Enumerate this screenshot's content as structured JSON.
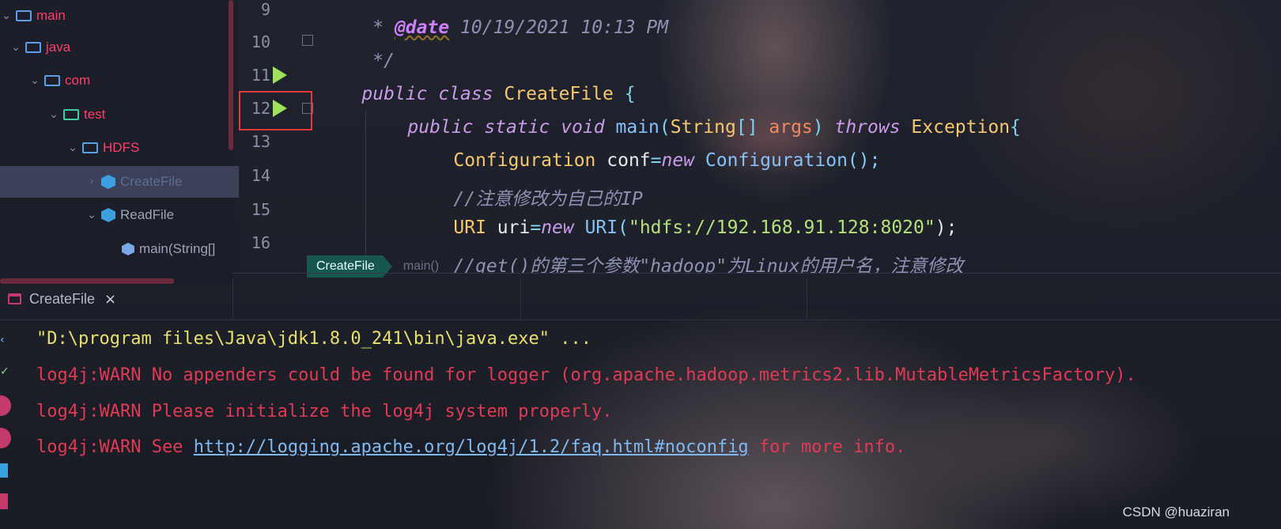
{
  "colors": {
    "accent_red": "#e83a3a",
    "run_green": "#9ee05a",
    "tree_text": "#ff3e6a",
    "breadcrumb_bg": "#16574f"
  },
  "project_tree": {
    "items": [
      {
        "label": "main",
        "type": "folder",
        "expanded": true
      },
      {
        "label": "java",
        "type": "folder",
        "expanded": true
      },
      {
        "label": "com",
        "type": "folder",
        "expanded": true
      },
      {
        "label": "test",
        "type": "package",
        "expanded": true
      },
      {
        "label": "HDFS",
        "type": "folder",
        "expanded": true
      },
      {
        "label": "CreateFile",
        "type": "class",
        "selected": true
      },
      {
        "label": "ReadFile",
        "type": "class",
        "expanded": true
      },
      {
        "label": "main(String[]",
        "type": "method"
      }
    ]
  },
  "editor": {
    "line_numbers": [
      "9",
      "10",
      "11",
      "12",
      "13",
      "14",
      "15",
      "16"
    ],
    "lines": {
      "l9": {
        "star": " * ",
        "anno": "@date",
        "rest": " 10/19/2021 10:13 PM"
      },
      "l10": {
        "text": " */"
      },
      "l11": {
        "kw": "public class ",
        "cls": "CreateFile",
        "punct": " {"
      },
      "l12": {
        "kw1": "public static void ",
        "fn": "main",
        "p1": "(",
        "cls": "String",
        "p2": "[] ",
        "param": "args",
        "p3": ") ",
        "kw2": "throws ",
        "cls2": "Exception",
        "p4": "{"
      },
      "l13": {
        "cls": "Configuration",
        "plain": " conf",
        "p1": "=",
        "kw": "new ",
        "fn": "Configuration",
        "p2": "();"
      },
      "l14": {
        "text": "//注意修改为自己的IP"
      },
      "l15": {
        "cls": "URI",
        "plain": " uri",
        "p1": "=",
        "kw": "new ",
        "fn": "URI",
        "p2": "(",
        "str": "\"hdfs://192.168.91.128:8020\"",
        "p3": ");"
      },
      "l16": {
        "text": "//get()的第三个参数\"hadoop\"为Linux的用户名，注意修改"
      }
    },
    "breadcrumb": [
      "CreateFile",
      "main()"
    ]
  },
  "run_panel": {
    "tab": {
      "label": "CreateFile",
      "close": "×"
    },
    "console": [
      {
        "text": "\"D:\\program files\\Java\\jdk1.8.0_241\\bin\\java.exe\" ...",
        "kind": "cmd"
      },
      {
        "text": "log4j:WARN No appenders could be found for logger (org.apache.hadoop.metrics2.lib.MutableMetricsFactory).",
        "kind": "warn"
      },
      {
        "text": "log4j:WARN Please initialize the log4j system properly.",
        "kind": "warn"
      }
    ],
    "last_line": {
      "prefix": "log4j:WARN See ",
      "link": "http://logging.apache.org/log4j/1.2/faq.html#noconfig",
      "suffix": " for more info."
    }
  },
  "watermark": "CSDN @huaziran"
}
